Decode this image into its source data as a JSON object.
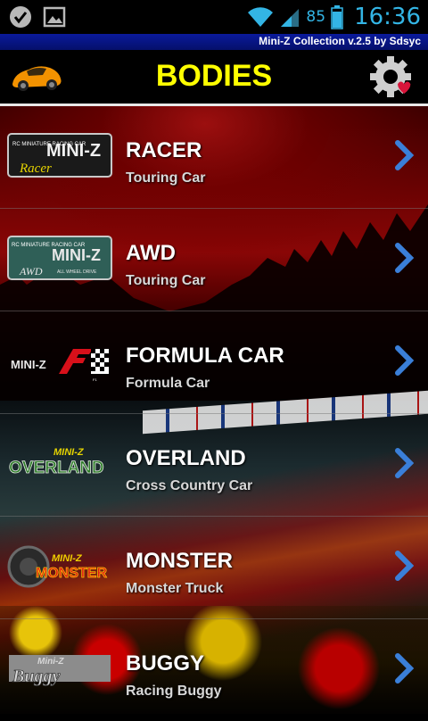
{
  "status_bar": {
    "battery_percent": "85",
    "clock": "16:36",
    "icons": [
      "check-icon",
      "image-icon",
      "wifi-icon",
      "signal-icon",
      "battery-icon"
    ]
  },
  "app": {
    "version_label": "Mini-Z Collection v.2.5 by Sdsyc"
  },
  "header": {
    "title": "BODIES",
    "title_color": "#ffff00"
  },
  "logos": {
    "racer": {
      "small": "RC MINIATURE RACING CAR",
      "main": "MINI-Z",
      "script": "Racer"
    },
    "awd": {
      "small": "RC MINIATURE RACING CAR",
      "main": "MINI-Z",
      "script": "AWD",
      "tag": "ALL WHEEL DRIVE"
    },
    "formula": {
      "main": "MINI-Z",
      "mark": "F1"
    },
    "overland": {
      "main": "MINI-Z",
      "script": "OVERLAND"
    },
    "monster": {
      "main": "MINI-Z",
      "script": "MONSTER"
    },
    "buggy": {
      "main": "Mini-Z",
      "script": "Buggy"
    }
  },
  "items": [
    {
      "title": "RACER",
      "subtitle": "Touring Car"
    },
    {
      "title": "AWD",
      "subtitle": "Touring Car"
    },
    {
      "title": "FORMULA CAR",
      "subtitle": "Formula Car"
    },
    {
      "title": "OVERLAND",
      "subtitle": "Cross Country Car"
    },
    {
      "title": "MONSTER",
      "subtitle": "Monster Truck"
    },
    {
      "title": "BUGGY",
      "subtitle": "Racing Buggy"
    }
  ],
  "colors": {
    "status_accent": "#33b5e5",
    "chevron": "#3a7fd9",
    "banner": "#0a1a9c"
  }
}
